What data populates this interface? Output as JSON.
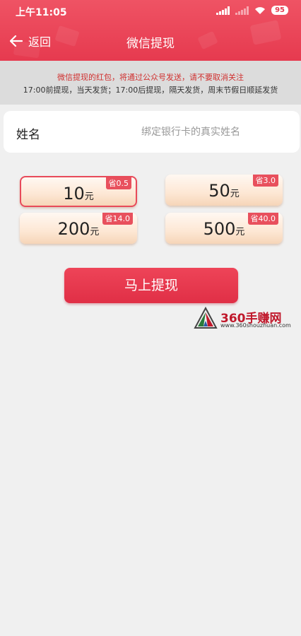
{
  "status_bar": {
    "time": "上午11:05",
    "battery": "95"
  },
  "nav": {
    "back_label": "返回",
    "title": "微信提现"
  },
  "notice": {
    "line1": "微信提现的红包，将通过公众号发送，请不要取消关注",
    "line2": "17:00前提现，当天发货；17:00后提现，隔天发货，周末节假日顺延发货"
  },
  "name_field": {
    "label": "姓名",
    "placeholder": "绑定银行卡的真实姓名",
    "value": ""
  },
  "amounts": [
    {
      "value": "10",
      "unit": "元",
      "save": "省0.5",
      "selected": true
    },
    {
      "value": "50",
      "unit": "元",
      "save": "省3.0",
      "selected": false
    },
    {
      "value": "200",
      "unit": "元",
      "save": "省14.0",
      "selected": false
    },
    {
      "value": "500",
      "unit": "元",
      "save": "省40.0",
      "selected": false
    }
  ],
  "submit": {
    "label": "马上提现"
  },
  "watermark": {
    "title": "360手赚网",
    "url": "www.360shouzhuan.com"
  },
  "colors": {
    "brand": "#e63a4f",
    "badge": "#e8505d",
    "notice_red": "#d0302f"
  }
}
